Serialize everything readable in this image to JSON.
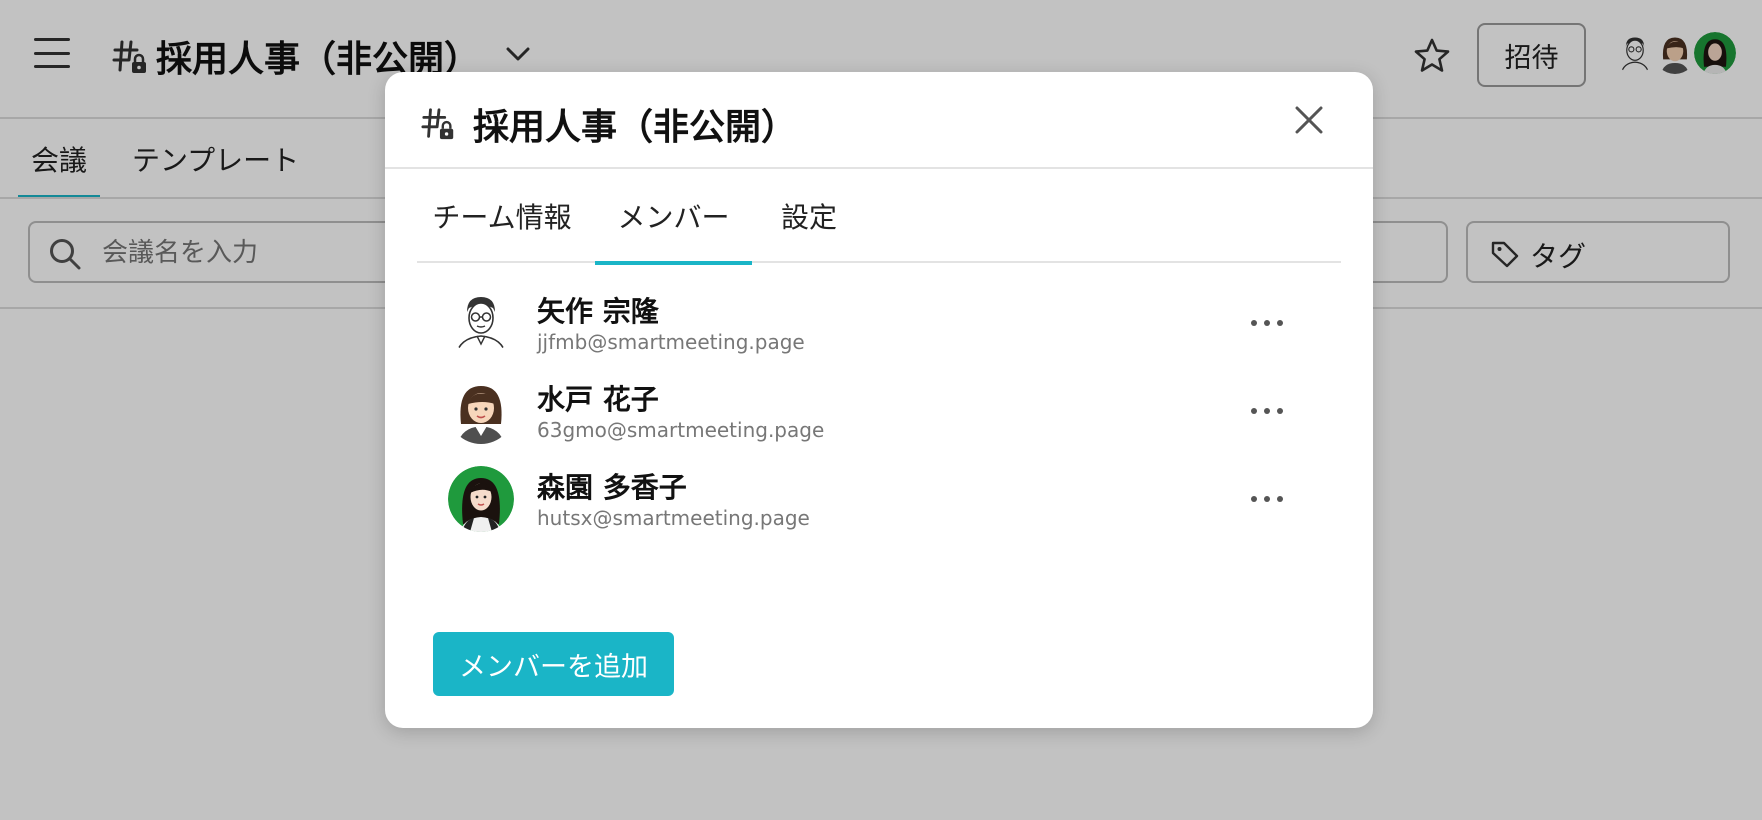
{
  "app": {
    "channel_title": "採用人事（非公開）",
    "invite_label": "招待",
    "tabs": [
      {
        "label": "会議",
        "active": true
      },
      {
        "label": "テンプレート",
        "active": false
      }
    ],
    "search": {
      "placeholder": "会議名を入力",
      "value": ""
    },
    "tag_filter_label": "タグ",
    "accent_color": "#1ab5c7"
  },
  "modal": {
    "title": "採用人事（非公開）",
    "tabs": [
      {
        "label": "チーム情報",
        "active": false
      },
      {
        "label": "メンバー",
        "active": true
      },
      {
        "label": "設定",
        "active": false
      }
    ],
    "members": [
      {
        "name": "矢作 宗隆",
        "email": "jjfmb@smartmeeting.page",
        "avatar": "illustrated-man-glasses"
      },
      {
        "name": "水戸 花子",
        "email": "63gmo@smartmeeting.page",
        "avatar": "illustrated-woman"
      },
      {
        "name": "森園 多香子",
        "email": "hutsx@smartmeeting.page",
        "avatar": "photo-woman-green-bg"
      }
    ],
    "add_member_label": "メンバーを追加"
  },
  "icons": {
    "menu": "hamburger-icon",
    "channel": "private-channel-icon",
    "chevron": "chevron-down-icon",
    "star": "star-icon",
    "search": "search-icon",
    "tag": "tag-icon",
    "close": "close-icon",
    "more": "more-horizontal-icon"
  }
}
